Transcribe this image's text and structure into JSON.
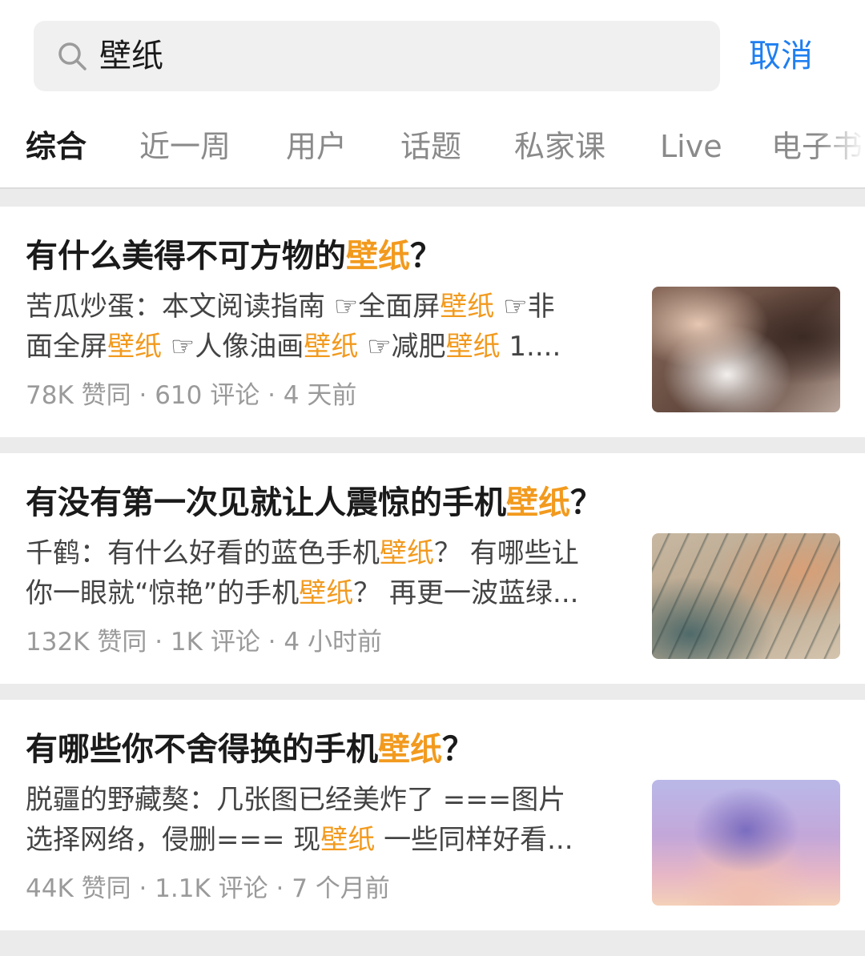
{
  "search": {
    "query": "壁纸",
    "cancel_label": "取消"
  },
  "tabs": [
    "综合",
    "近一周",
    "用户",
    "话题",
    "私家课",
    "Live",
    "电子书"
  ],
  "results": [
    {
      "title_before": "有什么美得不可方物的",
      "title_highlight": "壁纸",
      "title_after": "？",
      "excerpt_lines": [
        [
          {
            "t": "苦瓜炒蛋：本文阅读指南 ☞全面屏",
            "h": false
          },
          {
            "t": "壁纸",
            "h": true
          },
          {
            "t": " ☞非",
            "h": false
          }
        ],
        [
          {
            "t": "面全屏",
            "h": false
          },
          {
            "t": "壁纸",
            "h": true
          },
          {
            "t": " ☞人像油画",
            "h": false
          },
          {
            "t": "壁纸",
            "h": true
          },
          {
            "t": " ☞减肥",
            "h": false
          },
          {
            "t": "壁纸",
            "h": true
          },
          {
            "t": " 1....",
            "h": false
          }
        ]
      ],
      "meta": "78K 赞同 · 610 评论 · 4 天前"
    },
    {
      "title_before": "有没有第一次见就让人震惊的手机",
      "title_highlight": "壁纸",
      "title_after": "？",
      "excerpt_lines": [
        [
          {
            "t": "千鹤：有什么好看的蓝色手机",
            "h": false
          },
          {
            "t": "壁纸",
            "h": true
          },
          {
            "t": "？ 有哪些让",
            "h": false
          }
        ],
        [
          {
            "t": "你一眼就“惊艳”的手机",
            "h": false
          },
          {
            "t": "壁纸",
            "h": true
          },
          {
            "t": "？ 再更一波蓝绿...",
            "h": false
          }
        ]
      ],
      "meta": "132K 赞同 · 1K 评论 · 4 小时前"
    },
    {
      "title_before": "有哪些你不舍得换的手机",
      "title_highlight": "壁纸",
      "title_after": "？",
      "excerpt_lines": [
        [
          {
            "t": "脱疆的野藏獒：几张图已经美炸了 ===图片",
            "h": false
          }
        ],
        [
          {
            "t": "选择网络，侵删=== 现",
            "h": false
          },
          {
            "t": "壁纸",
            "h": true
          },
          {
            "t": " 一些同样好看...",
            "h": false
          }
        ]
      ],
      "meta": "44K 赞同 · 1.1K 评论 · 7 个月前"
    }
  ],
  "colors": {
    "accent": "#1f7ff0",
    "highlight": "#f29a1e"
  }
}
